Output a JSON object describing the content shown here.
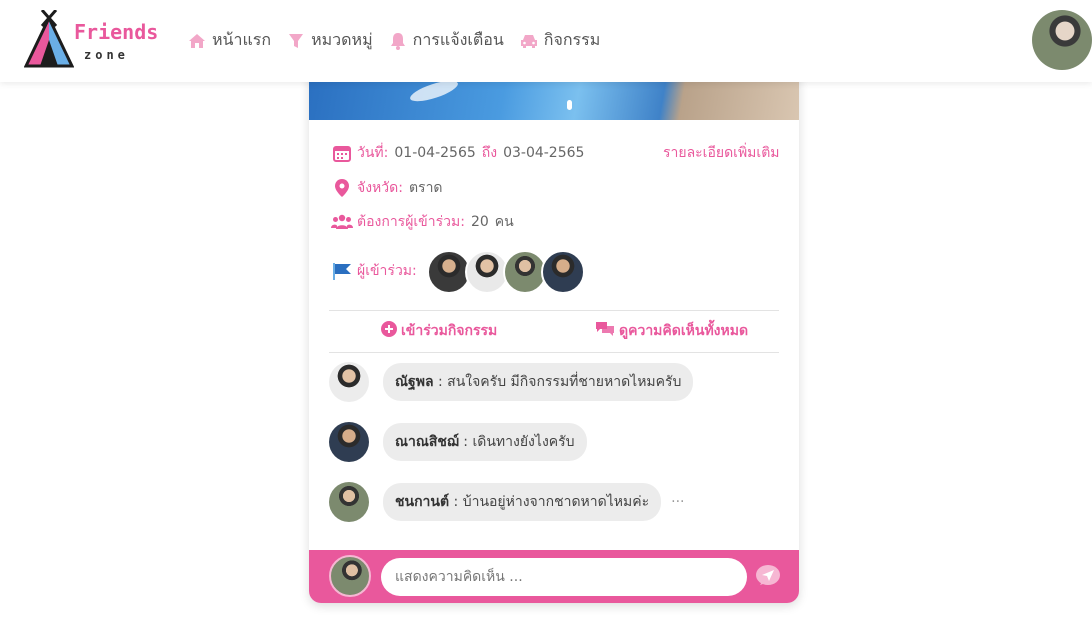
{
  "brand": {
    "name": "Friends",
    "sub": "zone",
    "accent": "#e9589c"
  },
  "nav": {
    "items": [
      {
        "icon": "home-icon",
        "label": "หน้าแรก"
      },
      {
        "icon": "filter-icon",
        "label": "หมวดหมู่"
      },
      {
        "icon": "bell-icon",
        "label": "การแจ้งเตือน"
      },
      {
        "icon": "car-icon",
        "label": "กิจกรรม"
      }
    ]
  },
  "event": {
    "date_label": "วันที่",
    "date_from": "01-04-2565",
    "to_label": "ถึง",
    "date_to": "03-04-2565",
    "more_details": "รายละเอียดเพิ่มเติม",
    "province_label": "จังหวัด",
    "province": "ตราด",
    "needed_label": "ต้องการผู้เข้าร่วม",
    "needed_count": "20",
    "needed_unit": "คน",
    "participants_label": "ผู้เข้าร่วม"
  },
  "actions": {
    "join": "เข้าร่วมกิจกรรม",
    "view_comments": "ดูความคิดเห็นทั้งหมด"
  },
  "comments": [
    {
      "name": "ณัฐพล",
      "text": "สนใจครับ มีกิจกรรมที่ชายหาดไหมครับ"
    },
    {
      "name": "ณาณสิชฌ์",
      "text": "เดินทางยังไงครับ"
    },
    {
      "name": "ชนกานต์",
      "text": "บ้านอยู่ห่างจากชาดหาดไหมค่ะ",
      "more": "···"
    }
  ],
  "comment_input": {
    "placeholder": "แสดงความคิดเห็น ..."
  }
}
